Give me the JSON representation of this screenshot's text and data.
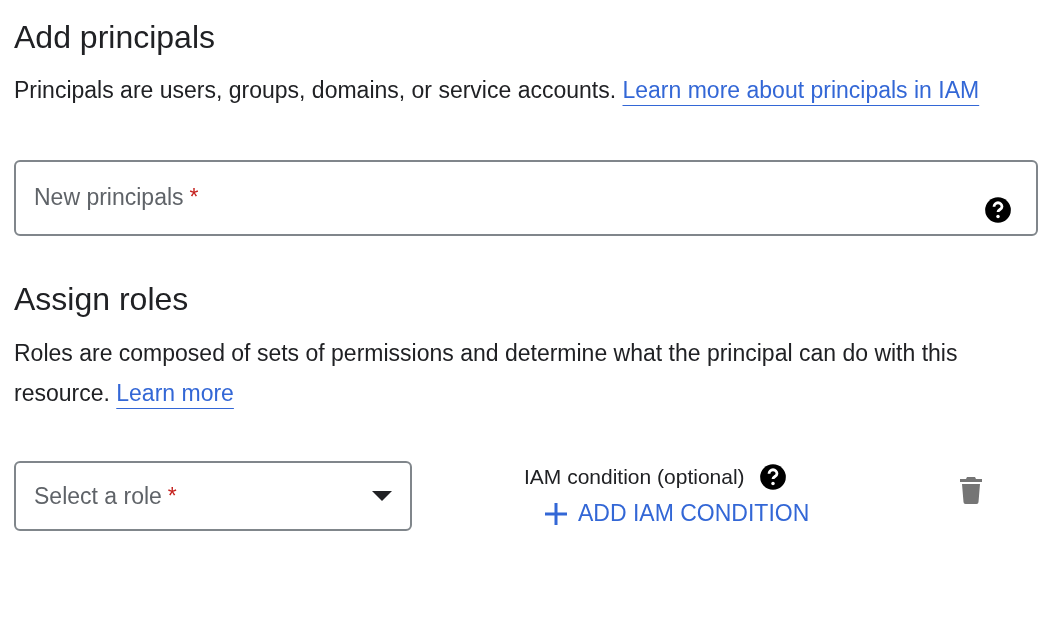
{
  "principals_section": {
    "heading": "Add principals",
    "description": "Principals are users, groups, domains, or service accounts.",
    "link": "Learn more about principals in IAM",
    "field": {
      "placeholder": "New principals",
      "required_mark": "*"
    }
  },
  "roles_section": {
    "heading": "Assign roles",
    "description": "Roles are composed of sets of permissions and determine what the principal can do with this resource.",
    "link": "Learn more",
    "role_select": {
      "placeholder": "Select a role",
      "required_mark": "*"
    },
    "condition_label": "IAM condition (optional)",
    "add_condition_button": "ADD IAM CONDITION"
  }
}
